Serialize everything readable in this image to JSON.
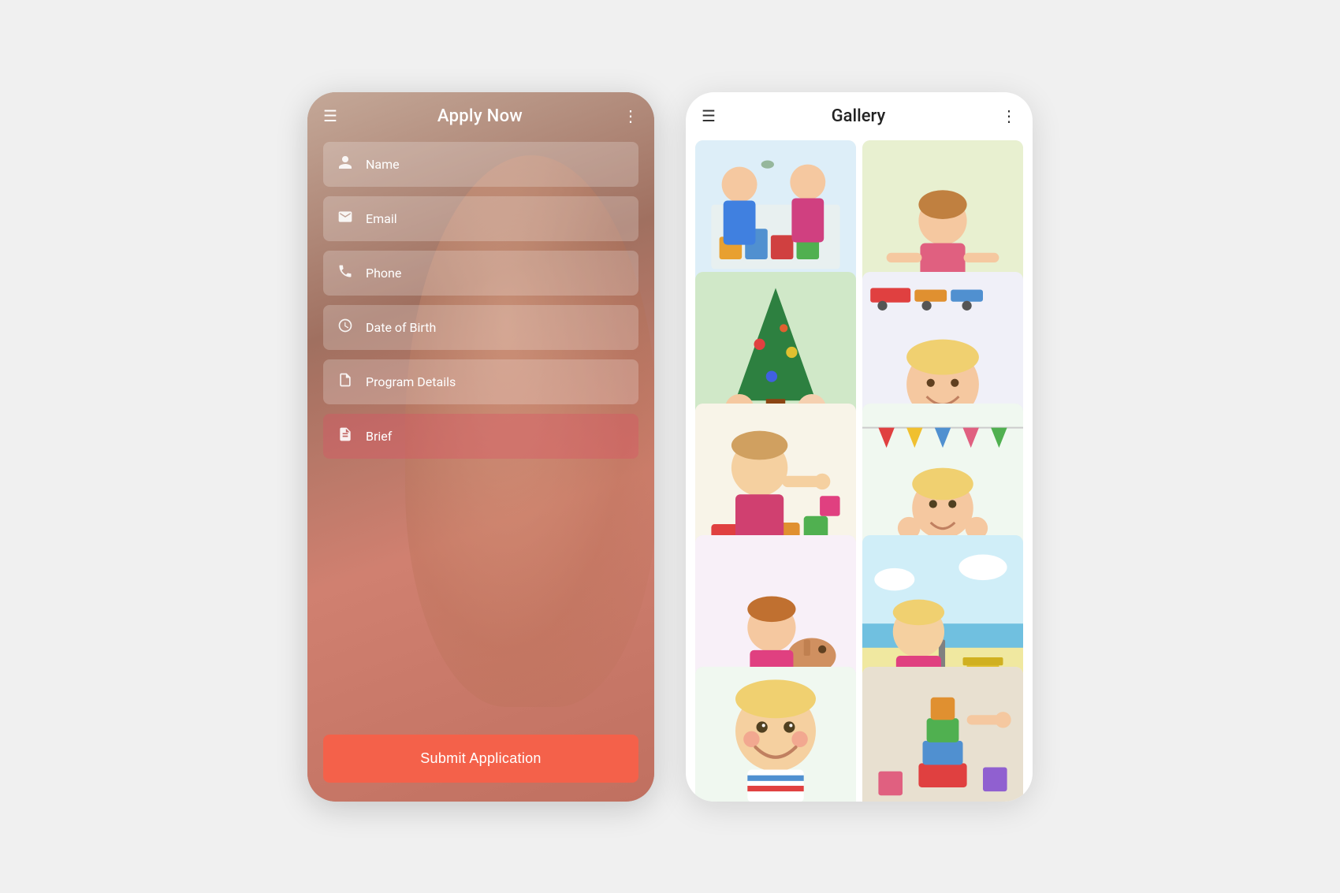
{
  "left_phone": {
    "top_bar": {
      "hamburger_label": "☰",
      "title": "Apply Now",
      "more_label": "⋮"
    },
    "form_fields": [
      {
        "id": "name",
        "icon": "👤",
        "label": "Name",
        "pink": false
      },
      {
        "id": "email",
        "icon": "✉",
        "label": "Email",
        "pink": false
      },
      {
        "id": "phone",
        "icon": "📞",
        "label": "Phone",
        "pink": false
      },
      {
        "id": "dob",
        "icon": "🕐",
        "label": "Date of Birth",
        "pink": false
      },
      {
        "id": "program",
        "icon": "📋",
        "label": "Program Details",
        "pink": false
      },
      {
        "id": "brief",
        "icon": "📄",
        "label": "Brief",
        "pink": true
      }
    ],
    "submit_label": "Submit Application"
  },
  "right_phone": {
    "top_bar": {
      "hamburger_label": "☰",
      "title": "Gallery",
      "more_label": "⋮"
    },
    "gallery_items": [
      {
        "id": "img1",
        "type": "children-blocks-1",
        "tall": true
      },
      {
        "id": "img2",
        "type": "children-train-1",
        "tall": false
      },
      {
        "id": "img3",
        "type": "children-xmas",
        "tall": false
      },
      {
        "id": "img4",
        "type": "children-colorful-1",
        "tall": true
      },
      {
        "id": "img5",
        "type": "children-blocks-2",
        "tall": true
      },
      {
        "id": "img6",
        "type": "children-striped",
        "tall": false
      },
      {
        "id": "img7",
        "type": "children-doll",
        "tall": true
      },
      {
        "id": "img8",
        "type": "children-beach",
        "tall": false
      },
      {
        "id": "img9",
        "type": "children-smile",
        "tall": false
      },
      {
        "id": "img10",
        "type": "children-toy",
        "tall": false
      }
    ]
  }
}
